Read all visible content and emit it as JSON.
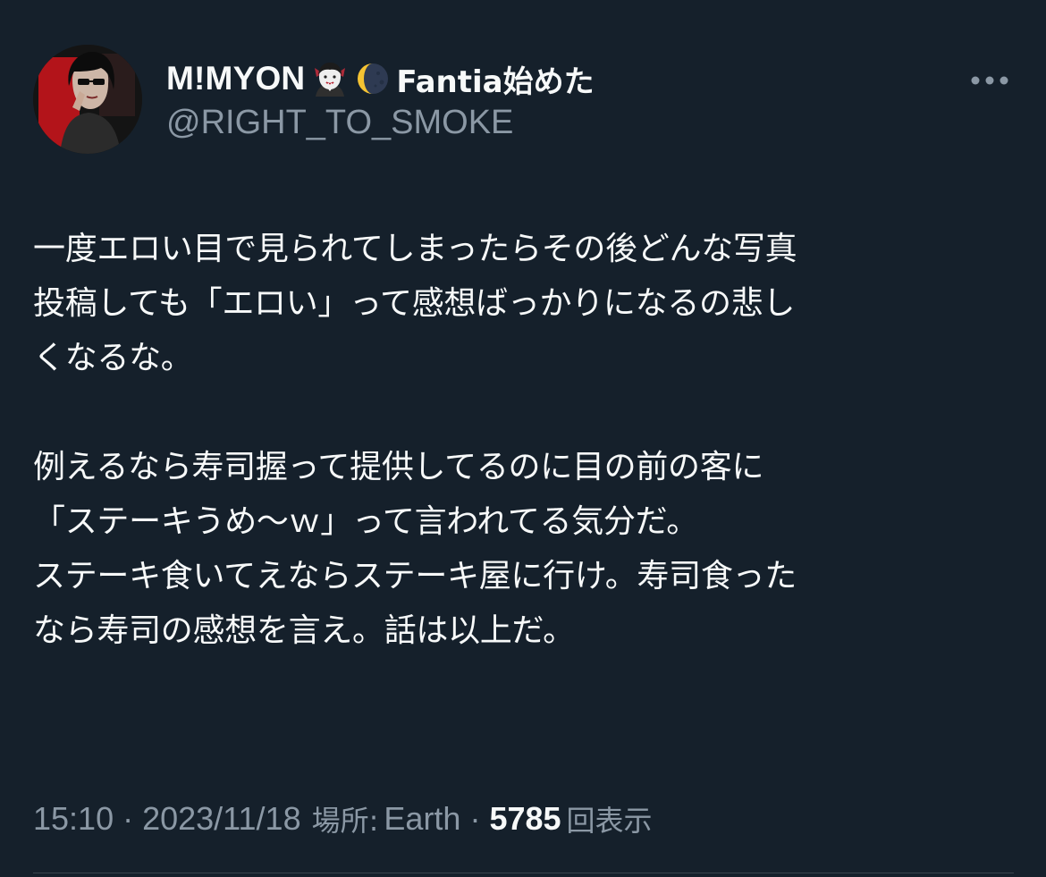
{
  "author": {
    "display_name": "M!MYON",
    "display_name_suffix": "Fantia始めた",
    "handle": "@RIGHT_TO_SMOKE",
    "name_emojis": [
      "vampire-emoji",
      "crescent-moon-emoji"
    ]
  },
  "tweet": {
    "paragraphs": [
      [
        "一度エロい目で見られてしまったらその後どんな写真",
        "投稿しても「エロい」って感想ばっかりになるの悲し",
        "くなるな。"
      ],
      [
        "例えるなら寿司握って提供してるのに目の前の客に",
        "「ステーキうめ〜ｗ」って言われてる気分だ。",
        "ステーキ食いてえならステーキ屋に行け。寿司食った",
        "なら寿司の感想を言え。話は以上だ。"
      ]
    ]
  },
  "meta": {
    "time": "15:10",
    "separator": "·",
    "date": "2023/11/18",
    "location_label": "場所:",
    "location": "Earth",
    "views_count": "5785",
    "views_label": "回表示"
  },
  "icons": {
    "more": "more-horizontal-icon"
  },
  "colors": {
    "background": "#15202b",
    "primary_text": "#f7f9f9",
    "secondary_text": "#8b98a5",
    "divider": "#38444d"
  }
}
